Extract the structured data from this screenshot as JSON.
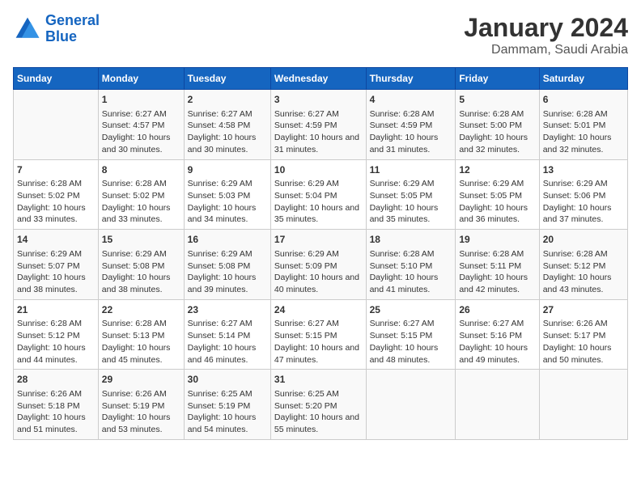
{
  "logo": {
    "line1": "General",
    "line2": "Blue"
  },
  "title": "January 2024",
  "subtitle": "Dammam, Saudi Arabia",
  "weekdays": [
    "Sunday",
    "Monday",
    "Tuesday",
    "Wednesday",
    "Thursday",
    "Friday",
    "Saturday"
  ],
  "weeks": [
    [
      {
        "num": "",
        "sunrise": "",
        "sunset": "",
        "daylight": ""
      },
      {
        "num": "1",
        "sunrise": "Sunrise: 6:27 AM",
        "sunset": "Sunset: 4:57 PM",
        "daylight": "Daylight: 10 hours and 30 minutes."
      },
      {
        "num": "2",
        "sunrise": "Sunrise: 6:27 AM",
        "sunset": "Sunset: 4:58 PM",
        "daylight": "Daylight: 10 hours and 30 minutes."
      },
      {
        "num": "3",
        "sunrise": "Sunrise: 6:27 AM",
        "sunset": "Sunset: 4:59 PM",
        "daylight": "Daylight: 10 hours and 31 minutes."
      },
      {
        "num": "4",
        "sunrise": "Sunrise: 6:28 AM",
        "sunset": "Sunset: 4:59 PM",
        "daylight": "Daylight: 10 hours and 31 minutes."
      },
      {
        "num": "5",
        "sunrise": "Sunrise: 6:28 AM",
        "sunset": "Sunset: 5:00 PM",
        "daylight": "Daylight: 10 hours and 32 minutes."
      },
      {
        "num": "6",
        "sunrise": "Sunrise: 6:28 AM",
        "sunset": "Sunset: 5:01 PM",
        "daylight": "Daylight: 10 hours and 32 minutes."
      }
    ],
    [
      {
        "num": "7",
        "sunrise": "Sunrise: 6:28 AM",
        "sunset": "Sunset: 5:02 PM",
        "daylight": "Daylight: 10 hours and 33 minutes."
      },
      {
        "num": "8",
        "sunrise": "Sunrise: 6:28 AM",
        "sunset": "Sunset: 5:02 PM",
        "daylight": "Daylight: 10 hours and 33 minutes."
      },
      {
        "num": "9",
        "sunrise": "Sunrise: 6:29 AM",
        "sunset": "Sunset: 5:03 PM",
        "daylight": "Daylight: 10 hours and 34 minutes."
      },
      {
        "num": "10",
        "sunrise": "Sunrise: 6:29 AM",
        "sunset": "Sunset: 5:04 PM",
        "daylight": "Daylight: 10 hours and 35 minutes."
      },
      {
        "num": "11",
        "sunrise": "Sunrise: 6:29 AM",
        "sunset": "Sunset: 5:05 PM",
        "daylight": "Daylight: 10 hours and 35 minutes."
      },
      {
        "num": "12",
        "sunrise": "Sunrise: 6:29 AM",
        "sunset": "Sunset: 5:05 PM",
        "daylight": "Daylight: 10 hours and 36 minutes."
      },
      {
        "num": "13",
        "sunrise": "Sunrise: 6:29 AM",
        "sunset": "Sunset: 5:06 PM",
        "daylight": "Daylight: 10 hours and 37 minutes."
      }
    ],
    [
      {
        "num": "14",
        "sunrise": "Sunrise: 6:29 AM",
        "sunset": "Sunset: 5:07 PM",
        "daylight": "Daylight: 10 hours and 38 minutes."
      },
      {
        "num": "15",
        "sunrise": "Sunrise: 6:29 AM",
        "sunset": "Sunset: 5:08 PM",
        "daylight": "Daylight: 10 hours and 38 minutes."
      },
      {
        "num": "16",
        "sunrise": "Sunrise: 6:29 AM",
        "sunset": "Sunset: 5:08 PM",
        "daylight": "Daylight: 10 hours and 39 minutes."
      },
      {
        "num": "17",
        "sunrise": "Sunrise: 6:29 AM",
        "sunset": "Sunset: 5:09 PM",
        "daylight": "Daylight: 10 hours and 40 minutes."
      },
      {
        "num": "18",
        "sunrise": "Sunrise: 6:28 AM",
        "sunset": "Sunset: 5:10 PM",
        "daylight": "Daylight: 10 hours and 41 minutes."
      },
      {
        "num": "19",
        "sunrise": "Sunrise: 6:28 AM",
        "sunset": "Sunset: 5:11 PM",
        "daylight": "Daylight: 10 hours and 42 minutes."
      },
      {
        "num": "20",
        "sunrise": "Sunrise: 6:28 AM",
        "sunset": "Sunset: 5:12 PM",
        "daylight": "Daylight: 10 hours and 43 minutes."
      }
    ],
    [
      {
        "num": "21",
        "sunrise": "Sunrise: 6:28 AM",
        "sunset": "Sunset: 5:12 PM",
        "daylight": "Daylight: 10 hours and 44 minutes."
      },
      {
        "num": "22",
        "sunrise": "Sunrise: 6:28 AM",
        "sunset": "Sunset: 5:13 PM",
        "daylight": "Daylight: 10 hours and 45 minutes."
      },
      {
        "num": "23",
        "sunrise": "Sunrise: 6:27 AM",
        "sunset": "Sunset: 5:14 PM",
        "daylight": "Daylight: 10 hours and 46 minutes."
      },
      {
        "num": "24",
        "sunrise": "Sunrise: 6:27 AM",
        "sunset": "Sunset: 5:15 PM",
        "daylight": "Daylight: 10 hours and 47 minutes."
      },
      {
        "num": "25",
        "sunrise": "Sunrise: 6:27 AM",
        "sunset": "Sunset: 5:15 PM",
        "daylight": "Daylight: 10 hours and 48 minutes."
      },
      {
        "num": "26",
        "sunrise": "Sunrise: 6:27 AM",
        "sunset": "Sunset: 5:16 PM",
        "daylight": "Daylight: 10 hours and 49 minutes."
      },
      {
        "num": "27",
        "sunrise": "Sunrise: 6:26 AM",
        "sunset": "Sunset: 5:17 PM",
        "daylight": "Daylight: 10 hours and 50 minutes."
      }
    ],
    [
      {
        "num": "28",
        "sunrise": "Sunrise: 6:26 AM",
        "sunset": "Sunset: 5:18 PM",
        "daylight": "Daylight: 10 hours and 51 minutes."
      },
      {
        "num": "29",
        "sunrise": "Sunrise: 6:26 AM",
        "sunset": "Sunset: 5:19 PM",
        "daylight": "Daylight: 10 hours and 53 minutes."
      },
      {
        "num": "30",
        "sunrise": "Sunrise: 6:25 AM",
        "sunset": "Sunset: 5:19 PM",
        "daylight": "Daylight: 10 hours and 54 minutes."
      },
      {
        "num": "31",
        "sunrise": "Sunrise: 6:25 AM",
        "sunset": "Sunset: 5:20 PM",
        "daylight": "Daylight: 10 hours and 55 minutes."
      },
      {
        "num": "",
        "sunrise": "",
        "sunset": "",
        "daylight": ""
      },
      {
        "num": "",
        "sunrise": "",
        "sunset": "",
        "daylight": ""
      },
      {
        "num": "",
        "sunrise": "",
        "sunset": "",
        "daylight": ""
      }
    ]
  ]
}
